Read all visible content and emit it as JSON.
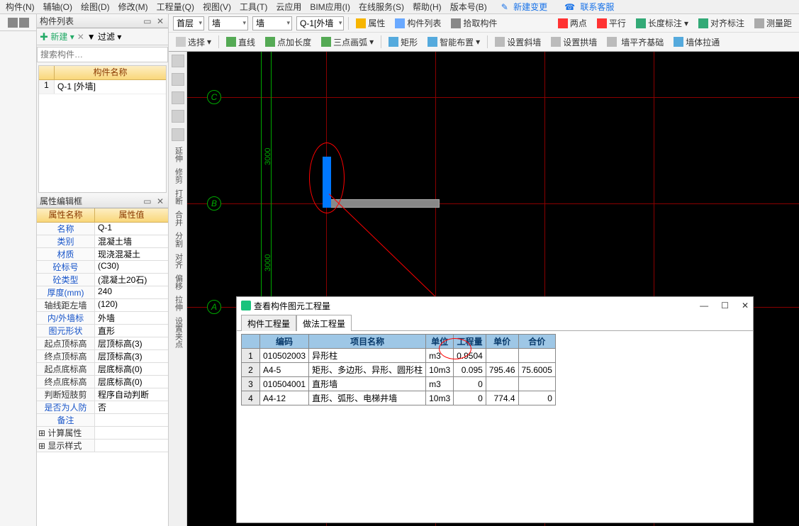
{
  "menu": {
    "items": [
      "构件(N)",
      "辅轴(O)",
      "绘图(D)",
      "修改(M)",
      "工程量(Q)",
      "视图(V)",
      "工具(T)",
      "云应用",
      "BIM应用(I)",
      "在线服务(S)",
      "帮助(H)",
      "版本号(B)"
    ],
    "new_change": "新建变更",
    "contact": "联系客服"
  },
  "left": {
    "component_list_title": "构件列表",
    "new_btn": "新建",
    "filter_btn": "过滤",
    "search_placeholder": "搜索构件…",
    "list_header": "构件名称",
    "list_rows": [
      {
        "n": "1",
        "name": "Q-1 [外墙]"
      }
    ],
    "prop_title": "属性编辑框",
    "prop_header": {
      "c1": "属性名称",
      "c2": "属性值"
    },
    "props": [
      {
        "k": "名称",
        "v": "Q-1",
        "blue": true
      },
      {
        "k": "类别",
        "v": "混凝土墙",
        "blue": true
      },
      {
        "k": "材质",
        "v": "现浇混凝土",
        "blue": true
      },
      {
        "k": "砼标号",
        "v": "(C30)",
        "blue": true
      },
      {
        "k": "砼类型",
        "v": "(混凝土20石)",
        "blue": true
      },
      {
        "k": "厚度(mm)",
        "v": "240",
        "blue": true
      },
      {
        "k": "轴线距左墙",
        "v": "(120)",
        "blue": false
      },
      {
        "k": "内/外墙标",
        "v": "外墙",
        "blue": true
      },
      {
        "k": "图元形状",
        "v": "直形",
        "blue": true
      },
      {
        "k": "起点顶标高",
        "v": "层顶标高(3)",
        "blue": false
      },
      {
        "k": "终点顶标高",
        "v": "层顶标高(3)",
        "blue": false
      },
      {
        "k": "起点底标高",
        "v": "层底标高(0)",
        "blue": false
      },
      {
        "k": "终点底标高",
        "v": "层底标高(0)",
        "blue": false
      },
      {
        "k": "判断短肢剪",
        "v": "程序自动判断",
        "blue": false
      },
      {
        "k": "是否为人防",
        "v": "否",
        "blue": true
      },
      {
        "k": "备注",
        "v": "",
        "blue": true
      }
    ],
    "exp_rows": [
      "计算属性",
      "显示样式"
    ]
  },
  "center": {
    "row1": {
      "combos": [
        "首层",
        "墙",
        "墙",
        "Q-1[外墙"
      ],
      "btns_a": [
        "属性",
        "构件列表",
        "拾取构件"
      ],
      "btns_b": [
        "两点",
        "平行",
        "长度标注",
        "对齐标注",
        "测量距"
      ]
    },
    "row2": {
      "btns": [
        "选择",
        "直线",
        "点加长度",
        "三点画弧",
        "矩形",
        "智能布置",
        "设置斜墙",
        "设置拱墙",
        "墙平齐基础",
        "墙体拉通"
      ]
    },
    "vlabels": [
      "延伸",
      "修剪",
      "打断",
      "合并",
      "分割",
      "对齐",
      "偏移",
      "拉伸",
      "设置夹点"
    ],
    "axis_labels": {
      "A": "A",
      "B": "B",
      "C": "C"
    },
    "dims": {
      "d1": "3000",
      "d2": "3000"
    }
  },
  "dialog": {
    "title": "查看构件图元工程量",
    "tabs": [
      "构件工程量",
      "做法工程量"
    ],
    "active_tab": 1,
    "headers": [
      "",
      "编码",
      "项目名称",
      "单位",
      "工程量",
      "单价",
      "合价"
    ],
    "rows": [
      {
        "n": "1",
        "code": "010502003",
        "name": "异形柱",
        "unit": "m3",
        "qty": "0.9504",
        "price": "",
        "total": ""
      },
      {
        "n": "2",
        "code": "A4-5",
        "name": "矩形、多边形、异形、圆形柱",
        "unit": "10m3",
        "qty": "0.095",
        "price": "795.46",
        "total": "75.6005"
      },
      {
        "n": "3",
        "code": "010504001",
        "name": "直形墙",
        "unit": "m3",
        "qty": "0",
        "price": "",
        "total": ""
      },
      {
        "n": "4",
        "code": "A4-12",
        "name": "直形、弧形、电梯井墙",
        "unit": "10m3",
        "qty": "0",
        "price": "774.4",
        "total": "0"
      }
    ],
    "window_btns": {
      "min": "—",
      "max": "☐",
      "close": "✕"
    }
  }
}
